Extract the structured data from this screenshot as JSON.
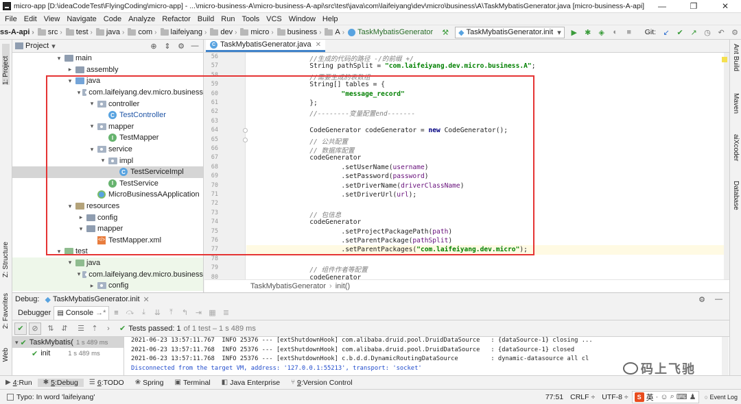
{
  "window": {
    "title": "micro-app [D:\\ideaCodeTest\\FlyingCoding\\micro-app] - ...\\micro-business-A\\micro-business-A-api\\src\\test\\java\\com\\laifeiyang\\dev\\micro\\business\\A\\TaskMybatisGenerator.java [micro-business-A-api] - I...",
    "controls": [
      "—",
      "❐",
      "✕"
    ]
  },
  "menu": [
    "File",
    "Edit",
    "View",
    "Navigate",
    "Code",
    "Analyze",
    "Refactor",
    "Build",
    "Run",
    "Tools",
    "VCS",
    "Window",
    "Help"
  ],
  "breadcrumb": [
    "ss-A-api",
    "src",
    "test",
    "java",
    "com",
    "laifeiyang",
    "dev",
    "micro",
    "business",
    "A",
    "TaskMybatisGenerator"
  ],
  "toolbar": {
    "run_config": "TaskMybatisGenerator.init",
    "git_label": "Git:"
  },
  "left_stripe": {
    "project": "1: Project",
    "structure": "Z: Structure",
    "favorites": "2: Favorites",
    "web": "Web"
  },
  "right_stripe": [
    "Ant Build",
    "Maven",
    "aiXcoder",
    "Database"
  ],
  "project_panel": {
    "title": "Project",
    "tree": [
      {
        "label": "main",
        "indent": 4,
        "arrow": "▾",
        "icon": "folder"
      },
      {
        "label": "assembly",
        "indent": 5,
        "arrow": "▸",
        "icon": "folder"
      },
      {
        "label": "java",
        "indent": 5,
        "arrow": "▾",
        "icon": "folder-blue"
      },
      {
        "label": "com.laifeiyang.dev.micro.business",
        "indent": 6,
        "arrow": "▾",
        "icon": "package"
      },
      {
        "label": "controller",
        "indent": 7,
        "arrow": "▾",
        "icon": "package"
      },
      {
        "label": "TestController",
        "indent": 8,
        "arrow": "",
        "icon": "class",
        "color": "blue"
      },
      {
        "label": "mapper",
        "indent": 7,
        "arrow": "▾",
        "icon": "package"
      },
      {
        "label": "TestMapper",
        "indent": 8,
        "arrow": "",
        "icon": "interface"
      },
      {
        "label": "service",
        "indent": 7,
        "arrow": "▾",
        "icon": "package"
      },
      {
        "label": "impl",
        "indent": 8,
        "arrow": "▾",
        "icon": "package"
      },
      {
        "label": "TestServiceImpl",
        "indent": 9,
        "arrow": "",
        "icon": "class",
        "selected": true
      },
      {
        "label": "TestService",
        "indent": 8,
        "arrow": "",
        "icon": "interface"
      },
      {
        "label": "MicroBusinessAApplication",
        "indent": 7,
        "arrow": "",
        "icon": "app"
      },
      {
        "label": "resources",
        "indent": 5,
        "arrow": "▾",
        "icon": "folder-res"
      },
      {
        "label": "config",
        "indent": 6,
        "arrow": "▸",
        "icon": "folder"
      },
      {
        "label": "mapper",
        "indent": 6,
        "arrow": "▾",
        "icon": "folder"
      },
      {
        "label": "TestMapper.xml",
        "indent": 7,
        "arrow": "",
        "icon": "xml"
      },
      {
        "label": "test",
        "indent": 4,
        "arrow": "▾",
        "icon": "folder-test"
      },
      {
        "label": "java",
        "indent": 5,
        "arrow": "▾",
        "icon": "folder-test",
        "test": true
      },
      {
        "label": "com.laifeiyang.dev.micro.business",
        "indent": 6,
        "arrow": "▾",
        "icon": "package",
        "test": true
      },
      {
        "label": "config",
        "indent": 7,
        "arrow": "▸",
        "icon": "package",
        "test": true
      }
    ]
  },
  "editor": {
    "tab": "TaskMybatisGenerator.java",
    "breadcrumb": [
      "TaskMybatisGenerator",
      "init()"
    ],
    "lines": [
      {
        "n": "56",
        "code": "        //生成的代码的路径 -/的前缀 +/"
      },
      {
        "n": "57",
        "code": "        String pathSplit = \"com.laifeiyang.dev.micro.business.A\";"
      },
      {
        "n": "58",
        "code": "        //需要生成的表数组"
      },
      {
        "n": "59",
        "code": "        String[] tables = {"
      },
      {
        "n": "60",
        "code": "                \"message_record\""
      },
      {
        "n": "61",
        "code": "        };"
      },
      {
        "n": "62",
        "code": "        //--------变量配置end-------"
      },
      {
        "n": "63",
        "code": ""
      },
      {
        "n": "64",
        "code": "        CodeGenerator codeGenerator = new CodeGenerator();"
      },
      {
        "n": "65",
        "code": "        // 公共配置"
      },
      {
        "n": "66",
        "code": "        // 数据库配置"
      },
      {
        "n": "67",
        "code": "        codeGenerator"
      },
      {
        "n": "68",
        "code": "                .setUserName(username)"
      },
      {
        "n": "69",
        "code": "                .setPassword(password)"
      },
      {
        "n": "70",
        "code": "                .setDriverName(driverClassName)"
      },
      {
        "n": "71",
        "code": "                .setDriverUrl(url);"
      },
      {
        "n": "72",
        "code": ""
      },
      {
        "n": "73",
        "code": "        // 包信息"
      },
      {
        "n": "74",
        "code": "        codeGenerator"
      },
      {
        "n": "75",
        "code": "                .setProjectPackagePath(path)"
      },
      {
        "n": "76",
        "code": "                .setParentPackage(pathSplit)"
      },
      {
        "n": "77",
        "code": "                .setParentPackages(\"com.laifeiyang.dev.micro\");"
      },
      {
        "n": "78",
        "code": ""
      },
      {
        "n": "79",
        "code": "        // 组件作者等配置"
      },
      {
        "n": "80",
        "code": "        codeGenerator"
      }
    ]
  },
  "debug": {
    "label": "Debug:",
    "session": "TaskMybatisGenerator.init",
    "tabs": [
      "Debugger",
      "Console"
    ],
    "tests_passed": "Tests passed: 1",
    "tests_detail": "of 1 test – 1 s 489 ms",
    "tree": [
      {
        "label": "TaskMybatis(",
        "time": "1 s 489 ms"
      },
      {
        "label": "init",
        "time": "1 s 489 ms"
      }
    ],
    "console": [
      {
        "text": "2021-06-23 13:57:11.767  INFO 25376 --- [extShutdownHook] com.alibaba.druid.pool.DruidDataSource   : {dataSource-1} closing ...",
        "blue": false
      },
      {
        "text": "2021-06-23 13:57:11.768  INFO 25376 --- [extShutdownHook] com.alibaba.druid.pool.DruidDataSource   : {dataSource-1} closed",
        "blue": false
      },
      {
        "text": "2021-06-23 13:57:11.768  INFO 25376 --- [extShutdownHook] c.b.d.d.DynamicRoutingDataSource         : dynamic-datasource all cl",
        "blue": false
      },
      {
        "text": "Disconnected from the target VM, address: '127.0.0.1:55213', transport: 'socket'",
        "blue": true
      }
    ]
  },
  "tool_windows": [
    {
      "num": "4",
      "label": "Run",
      "icon": "▶"
    },
    {
      "num": "5",
      "label": "Debug",
      "icon": "✱",
      "active": true
    },
    {
      "num": "6",
      "label": "TODO",
      "icon": "☰"
    },
    {
      "num": "",
      "label": "Spring",
      "icon": "❀"
    },
    {
      "num": "",
      "label": "Terminal",
      "icon": "▣"
    },
    {
      "num": "",
      "label": "Java Enterprise",
      "icon": "◧"
    },
    {
      "num": "9",
      "label": "Version Control",
      "icon": "⑂"
    }
  ],
  "status": {
    "message": "Typo: In word 'laifeiyang'",
    "position": "77:51",
    "line_sep": "CRLF",
    "encoding": "UTF-8",
    "event_log": "Event Log",
    "ime": "英"
  },
  "watermark": "码上飞驰"
}
